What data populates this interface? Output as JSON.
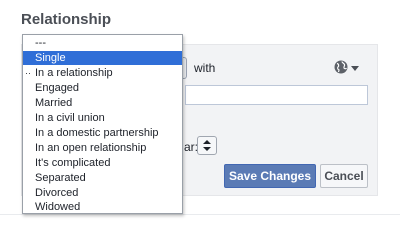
{
  "section": {
    "title": "Relationship"
  },
  "status_dropdown": {
    "options": [
      "---",
      "Single",
      "In a relationship",
      "Engaged",
      "Married",
      "In a civil union",
      "In a domestic partnership",
      "In an open relationship",
      "It's complicated",
      "Separated",
      "Divorced",
      "Widowed"
    ],
    "highlighted_option": "Single",
    "current_option_marker": "··",
    "highlight_color": "#2f6ed7"
  },
  "form": {
    "with_label": "with",
    "year_label": "ar:",
    "privacy_icon": "globe-icon",
    "save_label": "Save Changes",
    "cancel_label": "Cancel",
    "save_color": "#5b7bb5"
  }
}
